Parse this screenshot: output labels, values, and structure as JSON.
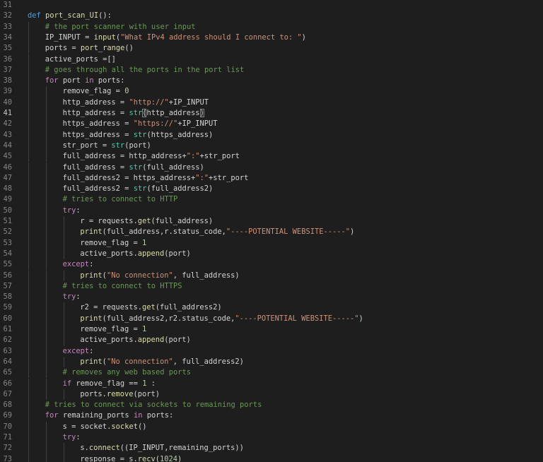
{
  "editor": {
    "active_line": 41,
    "lines": [
      {
        "no": "31",
        "indent": 0,
        "tokens": []
      },
      {
        "no": "32",
        "indent": 0,
        "tokens": [
          {
            "t": "def",
            "c": "def"
          },
          {
            "t": " "
          },
          {
            "t": "port_scan_UI",
            "c": "fn"
          },
          {
            "t": "():"
          }
        ]
      },
      {
        "no": "33",
        "indent": 1,
        "tokens": [
          {
            "t": "# the port scanner with user input",
            "c": "cmt"
          }
        ]
      },
      {
        "no": "34",
        "indent": 1,
        "tokens": [
          {
            "t": "IP_INPUT = "
          },
          {
            "t": "input",
            "c": "fn"
          },
          {
            "t": "("
          },
          {
            "t": "\"What IPv4 address should I connect to: \"",
            "c": "str"
          },
          {
            "t": ")"
          }
        ]
      },
      {
        "no": "35",
        "indent": 1,
        "tokens": [
          {
            "t": "ports = "
          },
          {
            "t": "port_range",
            "c": "fn"
          },
          {
            "t": "()"
          }
        ]
      },
      {
        "no": "36",
        "indent": 1,
        "tokens": [
          {
            "t": "active_ports =[]"
          }
        ]
      },
      {
        "no": "37",
        "indent": 1,
        "tokens": [
          {
            "t": "# goes through all the ports in the port list",
            "c": "cmt"
          }
        ]
      },
      {
        "no": "38",
        "indent": 1,
        "tokens": [
          {
            "t": "for",
            "c": "kw"
          },
          {
            "t": " port "
          },
          {
            "t": "in",
            "c": "kw"
          },
          {
            "t": " ports:"
          }
        ]
      },
      {
        "no": "39",
        "indent": 2,
        "tokens": [
          {
            "t": "remove_flag = "
          },
          {
            "t": "0",
            "c": "num"
          }
        ]
      },
      {
        "no": "40",
        "indent": 2,
        "tokens": [
          {
            "t": "http_address = "
          },
          {
            "t": "\"http://\"",
            "c": "str"
          },
          {
            "t": "+IP_INPUT"
          }
        ]
      },
      {
        "no": "41",
        "indent": 2,
        "tokens": [
          {
            "t": "http_address = "
          },
          {
            "t": "str",
            "c": "bin"
          },
          {
            "t": "(",
            "b": true
          },
          {
            "t": "http_address"
          },
          {
            "t": ")",
            "b": true
          }
        ]
      },
      {
        "no": "42",
        "indent": 2,
        "tokens": [
          {
            "t": "https_address = "
          },
          {
            "t": "\"https://\"",
            "c": "str"
          },
          {
            "t": "+IP_INPUT"
          }
        ]
      },
      {
        "no": "43",
        "indent": 2,
        "tokens": [
          {
            "t": "https_address = "
          },
          {
            "t": "str",
            "c": "bin"
          },
          {
            "t": "(https_address)"
          }
        ]
      },
      {
        "no": "44",
        "indent": 2,
        "tokens": [
          {
            "t": "str_port = "
          },
          {
            "t": "str",
            "c": "bin"
          },
          {
            "t": "(port)"
          }
        ]
      },
      {
        "no": "45",
        "indent": 2,
        "tokens": [
          {
            "t": "full_address = http_address+"
          },
          {
            "t": "\":\"",
            "c": "str"
          },
          {
            "t": "+str_port"
          }
        ]
      },
      {
        "no": "46",
        "indent": 2,
        "tokens": [
          {
            "t": "full_address = "
          },
          {
            "t": "str",
            "c": "bin"
          },
          {
            "t": "(full_address)"
          }
        ]
      },
      {
        "no": "47",
        "indent": 2,
        "tokens": [
          {
            "t": "full_address2 = https_address+"
          },
          {
            "t": "\":\"",
            "c": "str"
          },
          {
            "t": "+str_port"
          }
        ]
      },
      {
        "no": "48",
        "indent": 2,
        "tokens": [
          {
            "t": "full_address2 = "
          },
          {
            "t": "str",
            "c": "bin"
          },
          {
            "t": "(full_address2)"
          }
        ]
      },
      {
        "no": "49",
        "indent": 2,
        "tokens": [
          {
            "t": "# tries to connect to HTTP",
            "c": "cmt"
          }
        ]
      },
      {
        "no": "50",
        "indent": 2,
        "tokens": [
          {
            "t": "try",
            "c": "kw"
          },
          {
            "t": ":"
          }
        ]
      },
      {
        "no": "51",
        "indent": 3,
        "tokens": [
          {
            "t": "r = requests."
          },
          {
            "t": "get",
            "c": "fn"
          },
          {
            "t": "(full_address)"
          }
        ]
      },
      {
        "no": "52",
        "indent": 3,
        "tokens": [
          {
            "t": "print",
            "c": "fn"
          },
          {
            "t": "(full_address,r.status_code,"
          },
          {
            "t": "\"----POTENTIAL WEBSITE-----\"",
            "c": "str"
          },
          {
            "t": ")"
          }
        ]
      },
      {
        "no": "53",
        "indent": 3,
        "tokens": [
          {
            "t": "remove_flag = "
          },
          {
            "t": "1",
            "c": "num"
          }
        ]
      },
      {
        "no": "54",
        "indent": 3,
        "tokens": [
          {
            "t": "active_ports."
          },
          {
            "t": "append",
            "c": "fn"
          },
          {
            "t": "(port)"
          }
        ]
      },
      {
        "no": "55",
        "indent": 2,
        "tokens": [
          {
            "t": "except",
            "c": "kw"
          },
          {
            "t": ":"
          }
        ]
      },
      {
        "no": "56",
        "indent": 3,
        "tokens": [
          {
            "t": "print",
            "c": "fn"
          },
          {
            "t": "("
          },
          {
            "t": "\"No connection\"",
            "c": "str"
          },
          {
            "t": ", full_address)"
          }
        ]
      },
      {
        "no": "57",
        "indent": 2,
        "tokens": [
          {
            "t": "# tries to connect to HTTPS",
            "c": "cmt"
          }
        ]
      },
      {
        "no": "58",
        "indent": 2,
        "tokens": [
          {
            "t": "try",
            "c": "kw"
          },
          {
            "t": ":"
          }
        ]
      },
      {
        "no": "59",
        "indent": 3,
        "tokens": [
          {
            "t": "r2 = requests."
          },
          {
            "t": "get",
            "c": "fn"
          },
          {
            "t": "(full_address2)"
          }
        ]
      },
      {
        "no": "60",
        "indent": 3,
        "tokens": [
          {
            "t": "print",
            "c": "fn"
          },
          {
            "t": "(full_address2,r2.status_code,"
          },
          {
            "t": "\"----POTENTIAL WEBSITE-----\"",
            "c": "str"
          },
          {
            "t": ")"
          }
        ]
      },
      {
        "no": "61",
        "indent": 3,
        "tokens": [
          {
            "t": "remove_flag = "
          },
          {
            "t": "1",
            "c": "num"
          }
        ]
      },
      {
        "no": "62",
        "indent": 3,
        "tokens": [
          {
            "t": "active_ports."
          },
          {
            "t": "append",
            "c": "fn"
          },
          {
            "t": "(port)"
          }
        ]
      },
      {
        "no": "63",
        "indent": 2,
        "tokens": [
          {
            "t": "except",
            "c": "kw"
          },
          {
            "t": ":"
          }
        ]
      },
      {
        "no": "64",
        "indent": 3,
        "tokens": [
          {
            "t": "print",
            "c": "fn"
          },
          {
            "t": "("
          },
          {
            "t": "\"No connection\"",
            "c": "str"
          },
          {
            "t": ", full_address2)"
          }
        ]
      },
      {
        "no": "65",
        "indent": 2,
        "tokens": [
          {
            "t": "# removes any web based ports",
            "c": "cmt"
          }
        ]
      },
      {
        "no": "66",
        "indent": 2,
        "tokens": [
          {
            "t": "if",
            "c": "kw"
          },
          {
            "t": " remove_flag == "
          },
          {
            "t": "1",
            "c": "num"
          },
          {
            "t": " :"
          }
        ]
      },
      {
        "no": "67",
        "indent": 3,
        "tokens": [
          {
            "t": "ports."
          },
          {
            "t": "remove",
            "c": "fn"
          },
          {
            "t": "(port)"
          }
        ]
      },
      {
        "no": "68",
        "indent": 1,
        "tokens": [
          {
            "t": "# tries to connect via sockets to remaining ports",
            "c": "cmt"
          }
        ]
      },
      {
        "no": "69",
        "indent": 1,
        "tokens": [
          {
            "t": "for",
            "c": "kw"
          },
          {
            "t": " remaining_ports "
          },
          {
            "t": "in",
            "c": "kw"
          },
          {
            "t": " ports:"
          }
        ]
      },
      {
        "no": "70",
        "indent": 2,
        "tokens": [
          {
            "t": "s = socket."
          },
          {
            "t": "socket",
            "c": "fn"
          },
          {
            "t": "()"
          }
        ]
      },
      {
        "no": "71",
        "indent": 2,
        "tokens": [
          {
            "t": "try",
            "c": "kw"
          },
          {
            "t": ":"
          }
        ]
      },
      {
        "no": "72",
        "indent": 3,
        "tokens": [
          {
            "t": "s."
          },
          {
            "t": "connect",
            "c": "fn"
          },
          {
            "t": "((IP_INPUT,remaining_ports))"
          }
        ]
      },
      {
        "no": "73",
        "indent": 3,
        "tokens": [
          {
            "t": "response = s."
          },
          {
            "t": "recv",
            "c": "fn"
          },
          {
            "t": "("
          },
          {
            "t": "1024",
            "c": "num"
          },
          {
            "t": ")"
          }
        ]
      }
    ]
  }
}
